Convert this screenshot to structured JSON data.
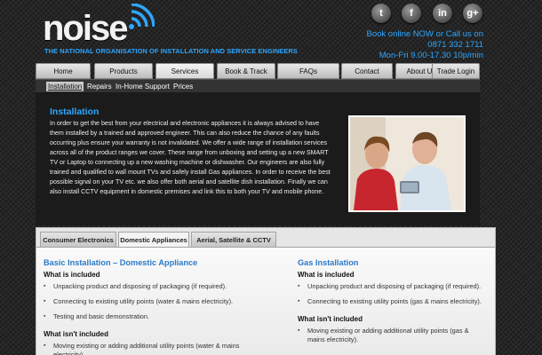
{
  "header": {
    "logo_text": "noise",
    "tagline": "THE NATIONAL ORGANISATION OF INSTALLATION AND SERVICE ENGINEERS",
    "social": [
      {
        "icon": "twitter-icon",
        "glyph": "t"
      },
      {
        "icon": "facebook-icon",
        "glyph": "f"
      },
      {
        "icon": "linkedin-icon",
        "glyph": "in"
      },
      {
        "icon": "googleplus-icon",
        "glyph": "g+"
      }
    ],
    "contact": {
      "line1": "Book online NOW or Call us on",
      "phone": "0871 332 1711",
      "hours": "Mon-Fri 9.00-17.30 10p/min"
    },
    "accent_color": "#2ea6ff"
  },
  "nav": {
    "items": [
      {
        "label": "Home"
      },
      {
        "label": "Products"
      },
      {
        "label": "Services"
      },
      {
        "label": "Book & Track"
      },
      {
        "label": "FAQs"
      },
      {
        "label": "Contact"
      },
      {
        "label": "About Us"
      },
      {
        "label": "Trade Login"
      }
    ],
    "active": "Services"
  },
  "subnav": {
    "items": [
      {
        "label": "Installation"
      },
      {
        "label": "Repairs"
      },
      {
        "label": "In-Home Support"
      },
      {
        "label": "Prices"
      }
    ],
    "active": "Installation"
  },
  "intro": {
    "title": "Installation",
    "text": "In order to get the best from your electrical and electronic appliances it is always advised to have them installed by a trained and approved engineer. This can also reduce the chance of any faults occurring plus ensure your warranty is not invalidated. We offer a wide range of installation services across all of the product ranges we cover. These range from unboxing and setting up a new SMART TV or Laptop to connecting up a new washing machine or dishwasher. Our engineers are also fully trained and qualified to wall mount TVs and safely install Gas appliances. In order to receive the best possible signal on your TV etc. we also offer both aerial and satellite dish installation. Finally we can also install CCTV equipment in domestic premises and link this to both your TV and mobile phone."
  },
  "tabs": {
    "items": [
      {
        "label": "Consumer Electronics"
      },
      {
        "label": "Domestic Appliances"
      },
      {
        "label": "Aerial, Satellite & CCTV"
      }
    ],
    "active": "Domestic Appliances"
  },
  "panel": {
    "left": {
      "title": "Basic Installation – Domestic Appliance",
      "included_title": "What is included",
      "included": [
        "Unpacking product and disposing of packaging (if required).",
        "Connecting to existing utility points (water & mains electricity).",
        "Testing and basic demonstration."
      ],
      "excluded_title": "What isn't included",
      "excluded": [
        "Moving existing or adding additional utility points (water & mains electricity)."
      ]
    },
    "right": {
      "title": "Gas Installation",
      "included_title": "What is included",
      "included": [
        "Unpacking product and disposing of packaging (if required).",
        "Connecting to existing utility points (gas & mains electricity)."
      ],
      "excluded_title": "What isn't included",
      "excluded": [
        "Moving existing or adding additional utility points (gas & mains electricity)."
      ]
    }
  }
}
